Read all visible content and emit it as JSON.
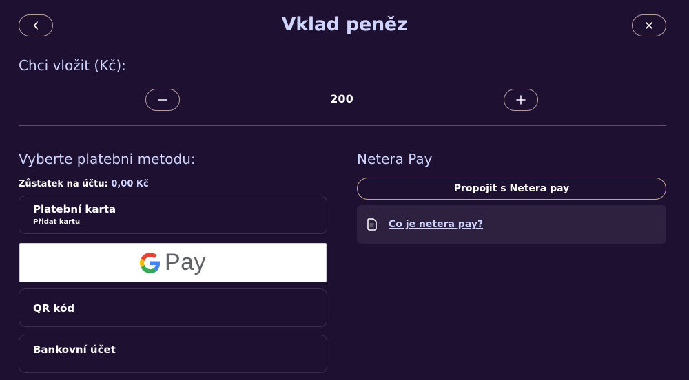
{
  "header": {
    "title": "Vklad peněz",
    "back_icon": "chevron-left-icon",
    "close_icon": "close-icon"
  },
  "amount": {
    "label": "Chci vložit (Kč):",
    "value": "200",
    "minus_icon": "minus-icon",
    "plus_icon": "plus-icon"
  },
  "methods": {
    "label": "Vyberte platebni metodu:",
    "balance_label": "Zůstatek na účtu:",
    "balance_value": "0,00 Kč",
    "card_title": "Platební karta",
    "card_subtitle": "Přidat kartu",
    "gpay_text": "Pay",
    "qr_title": "QR kód",
    "bank_title": "Bankovní účet"
  },
  "netera": {
    "label": "Netera Pay",
    "connect_label": "Propojit s Netera pay",
    "info_link": "Co je netera pay?",
    "info_icon": "document-icon"
  },
  "colors": {
    "background": "#1e1030",
    "accent_text": "#cfd5ff",
    "border": "#b99ea0",
    "card_border": "#3c2e4e",
    "info_bg": "#2e2140"
  }
}
